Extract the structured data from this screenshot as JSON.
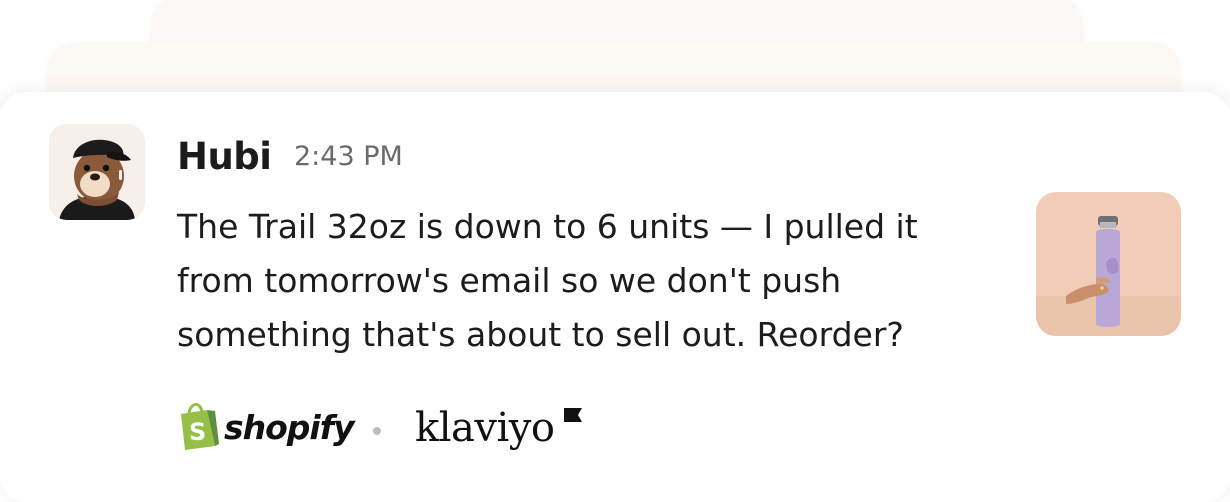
{
  "message": {
    "author": "Hubi",
    "timestamp": "2:43 PM",
    "lines": [
      "The Trail 32oz is down to 6 units — I pulled it",
      "from tomorrow's email so we don't push",
      "something that's about to sell out. Reorder?"
    ],
    "avatar_icon": "otter-avatar-icon",
    "attachment_icon": "water-bottle-product-icon"
  },
  "integrations": {
    "shopify_label": "shopify",
    "klaviyo_label": "klaviyo"
  },
  "colors": {
    "text": "#1d1c1d",
    "timestamp": "#6b6a6b",
    "shopify_green": "#95bf47",
    "stack_background": "#fcf8f5"
  }
}
